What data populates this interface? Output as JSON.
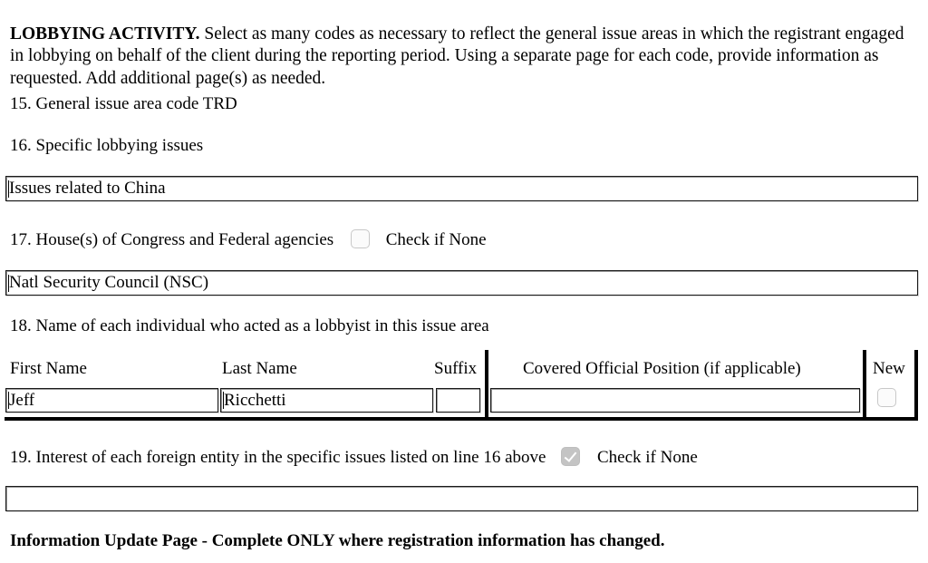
{
  "intro": {
    "lead": "LOBBYING ACTIVITY.",
    "body": " Select as many codes as necessary to reflect the general issue areas in which the registrant engaged in lobbying on behalf of the client during the reporting period. Using a separate page for each code, provide information as requested. Add additional page(s) as needed."
  },
  "item15": {
    "label": "15. General issue area code TRD"
  },
  "item16": {
    "label": "16. Specific lobbying issues",
    "value": "Issues related to China",
    "placeholder": ""
  },
  "item17": {
    "label": "17. House(s) of Congress and Federal agencies",
    "check_label": "Check if None",
    "checked": false,
    "value": "Natl Security Council (NSC)",
    "placeholder": ""
  },
  "item18": {
    "label": "18. Name of each individual who acted as a lobbyist in this issue area",
    "columns": [
      "First Name",
      "Last Name",
      "Suffix",
      "Covered Official Position (if applicable)",
      "New"
    ],
    "rows": [
      {
        "first_name": "Jeff",
        "last_name": "Ricchetti",
        "suffix": "",
        "covered_official_position": "",
        "new_checked": false
      }
    ]
  },
  "item19": {
    "label": "19. Interest of each foreign entity in the specific issues listed on line 16 above",
    "check_label": "Check if None",
    "checked": true,
    "value": "",
    "placeholder": ""
  },
  "footer": {
    "text": "Information Update Page - Complete ONLY where registration information has changed."
  }
}
